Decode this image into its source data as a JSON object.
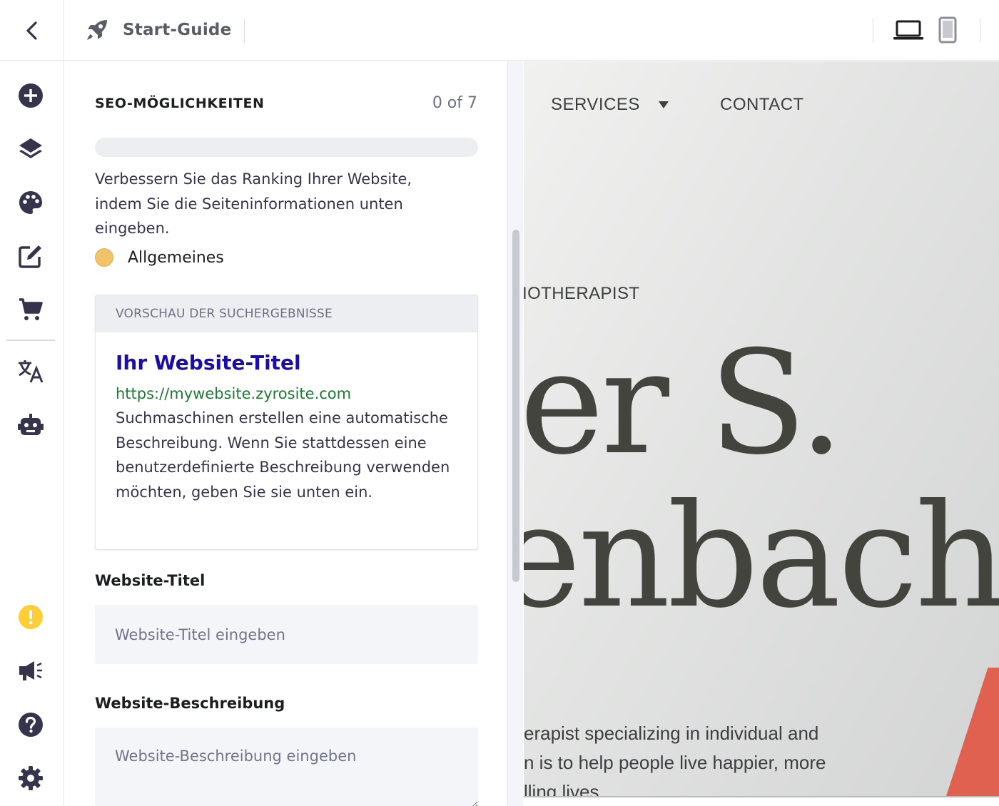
{
  "topbar": {
    "back_icon": "chevron-left-icon",
    "guide_icon": "rocket-icon",
    "guide_label": "Start-Guide",
    "devices": [
      "laptop-icon",
      "mobile-icon"
    ]
  },
  "rail": {
    "top_items": [
      "add-icon",
      "layers-icon",
      "palette-icon",
      "edit-icon",
      "cart-icon",
      "translate-icon",
      "robot-icon"
    ],
    "bottom_items": [
      "warning-icon",
      "megaphone-icon",
      "help-icon",
      "settings-icon"
    ],
    "warning_color": "#ffcd35"
  },
  "seo": {
    "title": "SEO-MÖGLICHKEITEN",
    "count": "0 of 7",
    "progress_fraction": 0,
    "description": "Verbessern Sie das Ranking Ihrer Website, indem Sie die Seiteninformationen unten eingeben.",
    "status": {
      "label": "Allgemeines",
      "color": "#f0c36a"
    },
    "preview": {
      "heading": "VORSCHAU DER SUCHERGEBNISSE",
      "title": "Ihr Website-Titel",
      "url": "https://mywebsite.zyrosite.com",
      "text": "Suchmaschinen erstellen eine automatische Beschreibung. Wenn Sie stattdessen eine benutzerdefinierte Beschreibung verwenden möchten, geben Sie sie unten ein."
    },
    "title_field": {
      "label": "Website-Titel",
      "placeholder": "Website-Titel eingeben",
      "value": ""
    },
    "description_field": {
      "label": "Website-Beschreibung",
      "placeholder": "Website-Beschreibung eingeben",
      "value": ""
    }
  },
  "site": {
    "nav": {
      "services": "SERVICES",
      "contact": "CONTACT"
    },
    "role": "IOTHERAPIST",
    "hero_line1": "er S.",
    "hero_line2": "enbach",
    "copy_line1": "erapist specializing in individual and",
    "copy_line2": "n is to help people live happier, more",
    "copy_line3": "lling lives.",
    "accent_color": "#e0614f"
  }
}
